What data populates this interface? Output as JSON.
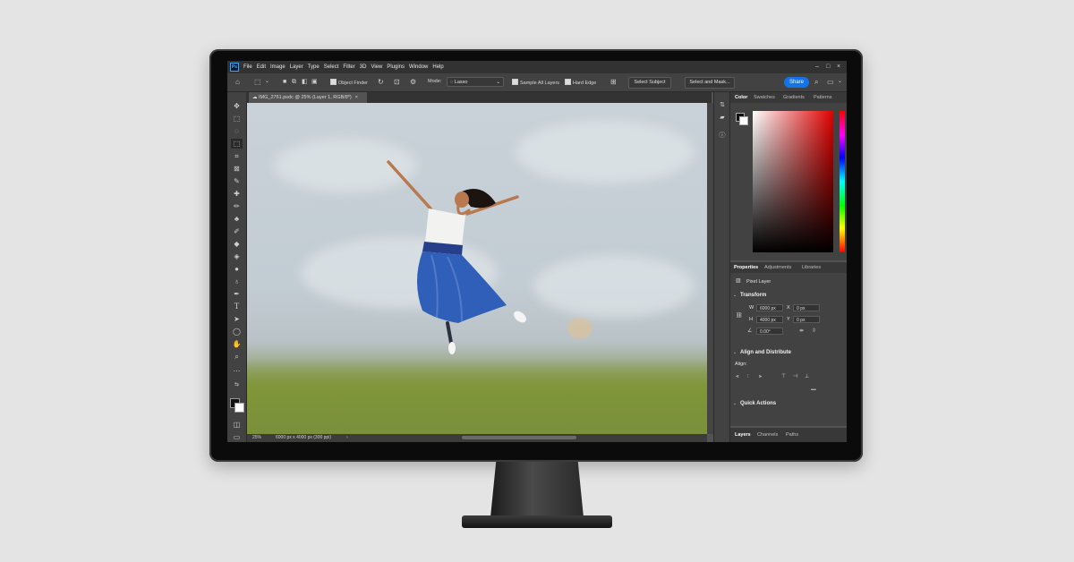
{
  "menu": [
    "File",
    "Edit",
    "Image",
    "Layer",
    "Type",
    "Select",
    "Filter",
    "3D",
    "View",
    "Plugins",
    "Window",
    "Help"
  ],
  "options_bar": {
    "object_finder": "Object Finder",
    "mode_label": "Mode:",
    "mode_value": "Lasso",
    "sample_all_layers": "Sample All Layers",
    "hard_edge": "Hard Edge",
    "select_subject": "Select Subject",
    "select_and_mask": "Select and Mask...",
    "share": "Share"
  },
  "document": {
    "tab_title": "IMG_2761.psdc @ 25% (Layer 1, RGB/8*)",
    "zoom": "25%",
    "dimensions": "6000 px x 4000 px (300 ppi)"
  },
  "color_panel": {
    "tabs": [
      "Color",
      "Swatches",
      "Gradients",
      "Patterns"
    ]
  },
  "properties_panel": {
    "tabs": [
      "Properties",
      "Adjustments",
      "Libraries"
    ],
    "layer_type": "Pixel Layer",
    "transform_title": "Transform",
    "w_label": "W",
    "w_value": "6000 px",
    "h_label": "H",
    "h_value": "4000 px",
    "x_label": "X",
    "x_value": "0 px",
    "y_label": "Y",
    "y_value": "0 px",
    "angle_value": "0.00°",
    "align_title": "Align and Distribute",
    "align_label": "Align:",
    "more": "•••",
    "quick_actions": "Quick Actions"
  },
  "layers_panel": {
    "tabs": [
      "Layers",
      "Channels",
      "Paths"
    ]
  },
  "icons": {
    "home": "home-icon",
    "move": "move-icon",
    "marquee": "marquee-icon",
    "lasso": "lasso-icon",
    "object_select": "object-selection-icon",
    "crop": "crop-icon",
    "frame": "frame-icon",
    "eyedropper": "eyedropper-icon",
    "heal": "healing-brush-icon",
    "brush": "brush-icon",
    "stamp": "clone-stamp-icon",
    "history": "history-brush-icon",
    "eraser": "eraser-icon",
    "bucket": "paint-bucket-icon",
    "blur": "blur-icon",
    "dodge": "dodge-icon",
    "pen": "pen-icon",
    "type": "type-icon",
    "path_select": "path-selection-icon",
    "shape": "ellipse-icon",
    "hand": "hand-icon",
    "zoom": "zoom-icon"
  },
  "colors": {
    "accent": "#1473e6",
    "panel": "#424242",
    "menubar": "#323232",
    "skirt": "#2f5fb8"
  }
}
